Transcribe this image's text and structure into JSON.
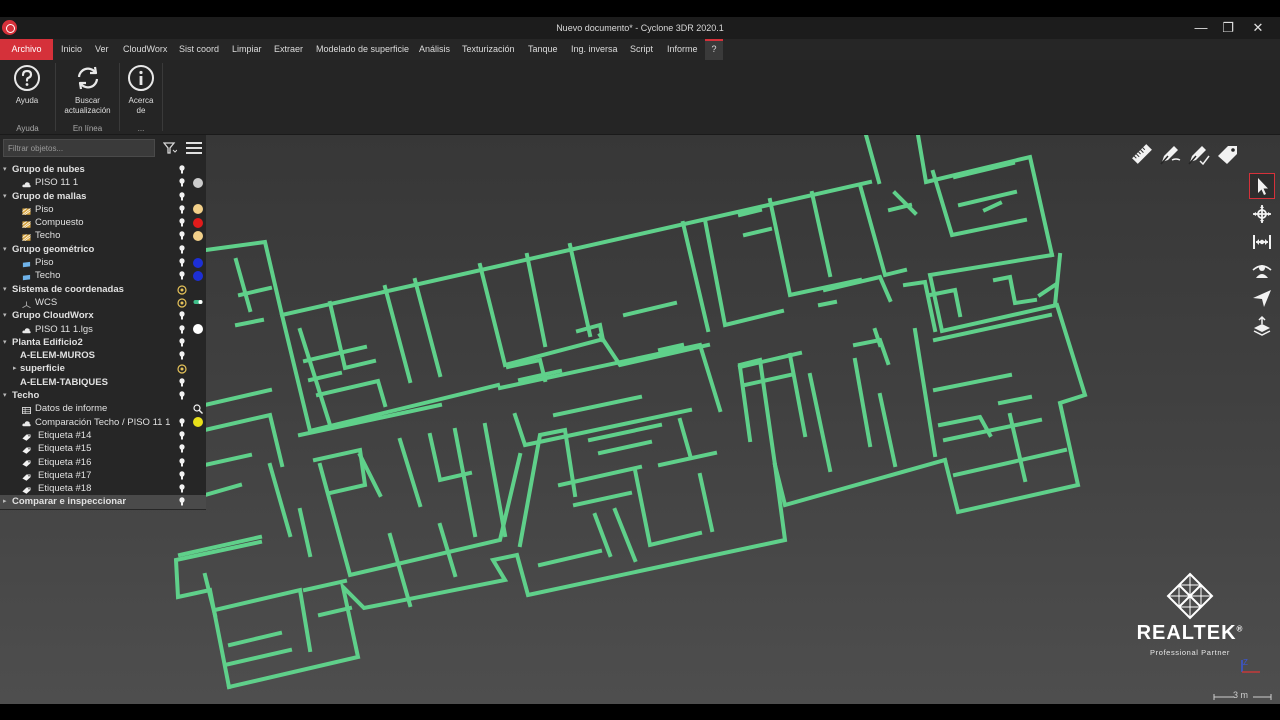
{
  "window": {
    "title": "Nuevo documento* - Cyclone 3DR 2020.1",
    "minimize": "—",
    "restore": "❐",
    "close": "✕"
  },
  "menu": {
    "items": [
      "Archivo",
      "Inicio",
      "Ver",
      "CloudWorx",
      "Sist coord",
      "Limpiar",
      "Extraer",
      "Modelado de superficie",
      "Análisis",
      "Texturización",
      "Tanque",
      "Ing. inversa",
      "Script",
      "Informe",
      "?"
    ],
    "active": "Archivo",
    "accent": "#d5313a"
  },
  "ribbon": {
    "groups": [
      {
        "label": "Ayuda",
        "buttons": [
          {
            "label": "Ayuda",
            "icon": "help-icon"
          }
        ]
      },
      {
        "label": "En línea",
        "buttons": [
          {
            "label": "Buscar actualización",
            "line1": "Buscar",
            "line2": "actualización",
            "icon": "refresh-icon"
          }
        ]
      },
      {
        "label": "...",
        "buttons": [
          {
            "label": "Acerca de",
            "line1": "Acerca",
            "line2": "de",
            "icon": "info-icon"
          }
        ]
      }
    ]
  },
  "tree": {
    "filter_placeholder": "Filtrar objetos...",
    "rows": [
      {
        "label": "Grupo de nubes",
        "level": 0,
        "group": true,
        "arrow": "down",
        "icon": ""
      },
      {
        "label": "PISO 11 1",
        "level": 1,
        "icon": "cloud-icon",
        "dot": "#cccccc",
        "dot_icon": "point-cloud-color-icon"
      },
      {
        "label": "Grupo de mallas",
        "level": 0,
        "group": true,
        "arrow": "down",
        "icon": ""
      },
      {
        "label": "Piso",
        "level": 1,
        "icon": "mesh-icon",
        "dot": "#f2d08a"
      },
      {
        "label": "Compuesto",
        "level": 1,
        "icon": "mesh-icon",
        "dot": "#e11b1b"
      },
      {
        "label": "Techo",
        "level": 1,
        "icon": "mesh-icon",
        "dot": "#f2d08a"
      },
      {
        "label": "Grupo geométrico",
        "level": 0,
        "group": true,
        "arrow": "down",
        "icon": ""
      },
      {
        "label": "Piso",
        "level": 1,
        "icon": "plane-icon",
        "dot": "#1d2fd6"
      },
      {
        "label": "Techo",
        "level": 1,
        "icon": "plane-icon",
        "dot": "#1d2fd6"
      },
      {
        "label": "Sistema de coordenadas",
        "level": 0,
        "group": true,
        "arrow": "down",
        "icon": "",
        "vis": "multi"
      },
      {
        "label": "WCS",
        "level": 1,
        "icon": "axes-icon",
        "vis": "multi",
        "dot": "",
        "dot_icon": "toggle-icon"
      },
      {
        "label": "Grupo CloudWorx",
        "level": 0,
        "group": true,
        "arrow": "down",
        "icon": ""
      },
      {
        "label": "PISO 11 1.lgs",
        "level": 1,
        "icon": "cloud-icon",
        "dot": "#ffffff"
      },
      {
        "label": "Planta Edificio2",
        "level": 0,
        "group": true,
        "arrow": "down",
        "icon": ""
      },
      {
        "label": "A-ELEM-MUROS",
        "level": 1,
        "group": true,
        "icon": ""
      },
      {
        "label": "superficie",
        "level": 1,
        "group": true,
        "arrow": "right",
        "icon": "",
        "vis": "multi"
      },
      {
        "label": "A-ELEM-TABIQUES",
        "level": 1,
        "group": true,
        "icon": ""
      },
      {
        "label": "Techo",
        "level": 0,
        "group": true,
        "arrow": "down",
        "icon": ""
      },
      {
        "label": "Datos de informe",
        "level": 1,
        "icon": "table-icon",
        "vis": "none",
        "dot": "",
        "dot_icon": "magnifier-icon"
      },
      {
        "label": "Comparación Techo / PISO 11 1",
        "level": 1,
        "icon": "cloud-icon",
        "dot": "#e8e01a"
      },
      {
        "label": "Etiqueta #14",
        "level": 1,
        "icon": "label-tag-icon"
      },
      {
        "label": "Etiqueta #15",
        "level": 1,
        "icon": "label-tag-icon"
      },
      {
        "label": "Etiqueta #16",
        "level": 1,
        "icon": "label-tag-icon"
      },
      {
        "label": "Etiqueta #17",
        "level": 1,
        "icon": "label-tag-icon"
      },
      {
        "label": "Etiqueta #18",
        "level": 1,
        "icon": "label-tag-icon"
      },
      {
        "label": "Comparar e inspeccionar",
        "level": 0,
        "group": true,
        "arrow": "right",
        "icon": "",
        "selected": true
      }
    ]
  },
  "viewport": {
    "line_color": "#5fd08a",
    "top_tools": [
      "ruler-icon",
      "label-pen-icon",
      "label-pen-check-icon",
      "tag-icon"
    ],
    "side_tools": [
      "select-cursor-icon",
      "move-cross-icon",
      "fit-horizontal-icon",
      "viewer-person-icon",
      "send-arrow-icon",
      "layers-icon"
    ],
    "scale_label": "3 m"
  },
  "brand": {
    "name": "REALTEK",
    "registered": "®",
    "subtitle": "Professional Partner"
  }
}
